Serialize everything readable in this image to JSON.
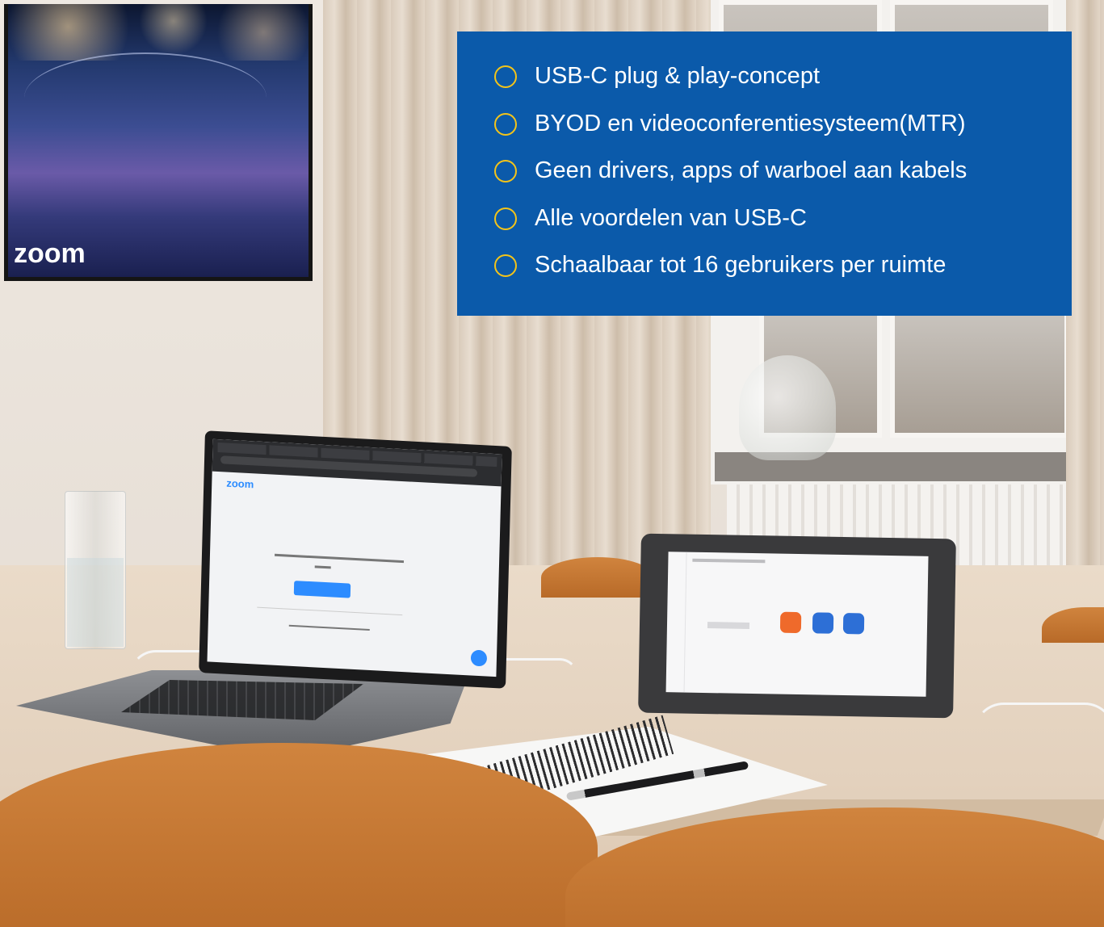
{
  "tv": {
    "logo_text": "zoom"
  },
  "features": {
    "items": [
      {
        "label": "USB-C plug & play-concept"
      },
      {
        "label": "BYOD en videoconferentiesysteem(MTR)"
      },
      {
        "label": "Geen drivers, apps of warboel aan kabels"
      },
      {
        "label": "Alle voordelen van USB-C"
      },
      {
        "label": "Schaalbaar tot 16 gebruikers per ruimte"
      }
    ],
    "colors": {
      "panel": "#0b5aaa",
      "bullet": "#f4c419",
      "text": "#ffffff"
    }
  },
  "laptop_screen": {
    "logo_text": "zoom",
    "brand_color": "#2d8cff"
  },
  "tablet_screen": {
    "buttons": [
      "orange-camera-icon",
      "blue-video-icon",
      "blue-share-icon"
    ]
  }
}
